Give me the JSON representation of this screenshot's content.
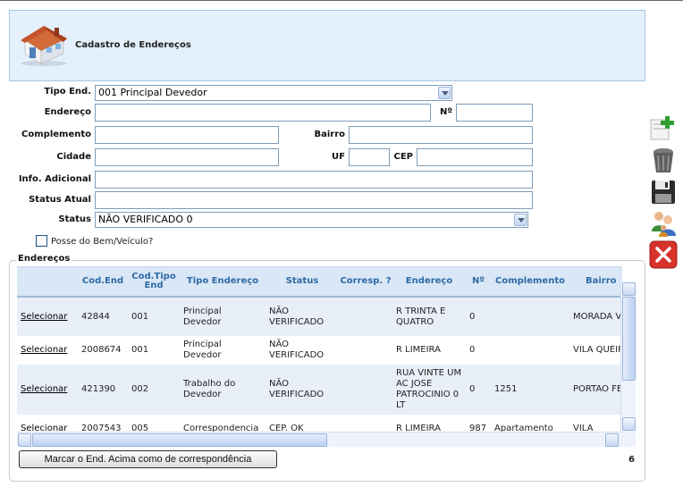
{
  "header": {
    "title": "Cadastro de Endereços",
    "icon": "house-icon"
  },
  "form": {
    "tipo_end_label": "Tipo End.",
    "tipo_end_value": "001 Principal Devedor",
    "endereco_label": "Endereço",
    "endereco_value": "",
    "numero_label": "Nº",
    "numero_value": "",
    "complemento_label": "Complemento",
    "complemento_value": "",
    "bairro_label": "Bairro",
    "bairro_value": "",
    "cidade_label": "Cidade",
    "cidade_value": "",
    "uf_label": "UF",
    "uf_value": "",
    "cep_label": "CEP",
    "cep_value": "",
    "info_label": "Info. Adicional",
    "info_value": "",
    "status_atual_label": "Status Atual",
    "status_atual_value": "",
    "status_label": "Status",
    "status_value": "NÃO VERIFICADO 0",
    "posse_label": "Posse do Bem/Veículo?"
  },
  "enderecos": {
    "legend": "Endereços",
    "columns": [
      "",
      "Cod.End",
      "Cod.Tipo End",
      "Tipo Endereço",
      "Status",
      "Corresp. ?",
      "Endereço",
      "Nº",
      "Complemento",
      "Bairro"
    ],
    "rows": [
      {
        "action": "Selecionar",
        "cod_end": "42844",
        "cod_tipo": "001",
        "tipo": "Principal Devedor",
        "status": "NÃO VERIFICADO",
        "corresp": "",
        "endereco": "R TRINTA E QUATRO",
        "numero": "0",
        "complemento": "",
        "bairro": "MORADA VALE"
      },
      {
        "action": "Selecionar",
        "cod_end": "2008674",
        "cod_tipo": "001",
        "tipo": "Principal Devedor",
        "status": "NÃO VERIFICADO",
        "corresp": "",
        "endereco": "R LIMEIRA",
        "numero": "0",
        "complemento": "",
        "bairro": "VILA QUEIROZ"
      },
      {
        "action": "Selecionar",
        "cod_end": "421390",
        "cod_tipo": "002",
        "tipo": "Trabalho do Devedor",
        "status": "NÃO VERIFICADO",
        "corresp": "",
        "endereco": "RUA VINTE UM AC JOSE PATROCINIO 0 LT",
        "numero": "0",
        "complemento": "1251",
        "bairro": "PORTAO FERRO"
      },
      {
        "action": "Selecionar",
        "cod_end": "2007543",
        "cod_tipo": "005",
        "tipo": "Correspondencia",
        "status": "CEP. OK",
        "corresp": "",
        "endereco": "R LIMEIRA",
        "numero": "987",
        "complemento": "Apartamento",
        "bairro": "VILA"
      }
    ],
    "mark_button": "Marcar o End. Acima como de correspondência",
    "count": "6"
  },
  "side_icons": [
    "add-doc-icon",
    "trash-icon",
    "save-icon",
    "users-icon",
    "close-icon"
  ]
}
